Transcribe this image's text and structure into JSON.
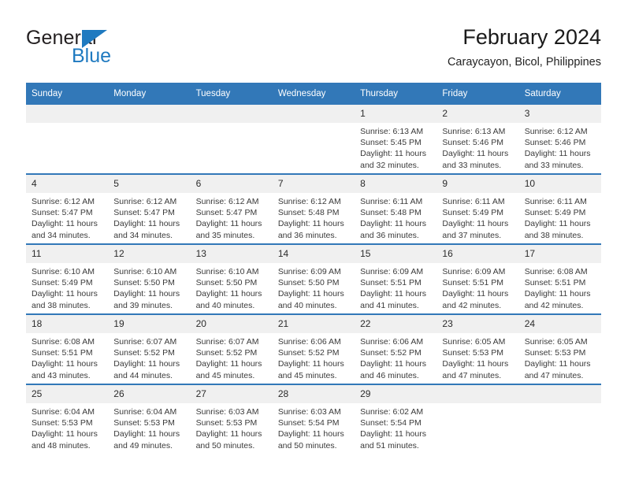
{
  "brand": {
    "name_dark": "General",
    "name_blue": "Blue",
    "triangle_icon": "triangle-logo-icon",
    "blue": "#1f7ac0"
  },
  "header": {
    "title": "February 2024",
    "subtitle": "Caraycayon, Bicol, Philippines"
  },
  "theme": {
    "header_blue": "#3278b8",
    "daynum_gray": "#f0f0f0"
  },
  "calendar": {
    "weekdays": [
      "Sunday",
      "Monday",
      "Tuesday",
      "Wednesday",
      "Thursday",
      "Friday",
      "Saturday"
    ],
    "weeks": [
      [
        {
          "day": "",
          "lines": []
        },
        {
          "day": "",
          "lines": []
        },
        {
          "day": "",
          "lines": []
        },
        {
          "day": "",
          "lines": []
        },
        {
          "day": "1",
          "lines": [
            "Sunrise: 6:13 AM",
            "Sunset: 5:45 PM",
            "Daylight: 11 hours and 32 minutes."
          ]
        },
        {
          "day": "2",
          "lines": [
            "Sunrise: 6:13 AM",
            "Sunset: 5:46 PM",
            "Daylight: 11 hours and 33 minutes."
          ]
        },
        {
          "day": "3",
          "lines": [
            "Sunrise: 6:12 AM",
            "Sunset: 5:46 PM",
            "Daylight: 11 hours and 33 minutes."
          ]
        }
      ],
      [
        {
          "day": "4",
          "lines": [
            "Sunrise: 6:12 AM",
            "Sunset: 5:47 PM",
            "Daylight: 11 hours and 34 minutes."
          ]
        },
        {
          "day": "5",
          "lines": [
            "Sunrise: 6:12 AM",
            "Sunset: 5:47 PM",
            "Daylight: 11 hours and 34 minutes."
          ]
        },
        {
          "day": "6",
          "lines": [
            "Sunrise: 6:12 AM",
            "Sunset: 5:47 PM",
            "Daylight: 11 hours and 35 minutes."
          ]
        },
        {
          "day": "7",
          "lines": [
            "Sunrise: 6:12 AM",
            "Sunset: 5:48 PM",
            "Daylight: 11 hours and 36 minutes."
          ]
        },
        {
          "day": "8",
          "lines": [
            "Sunrise: 6:11 AM",
            "Sunset: 5:48 PM",
            "Daylight: 11 hours and 36 minutes."
          ]
        },
        {
          "day": "9",
          "lines": [
            "Sunrise: 6:11 AM",
            "Sunset: 5:49 PM",
            "Daylight: 11 hours and 37 minutes."
          ]
        },
        {
          "day": "10",
          "lines": [
            "Sunrise: 6:11 AM",
            "Sunset: 5:49 PM",
            "Daylight: 11 hours and 38 minutes."
          ]
        }
      ],
      [
        {
          "day": "11",
          "lines": [
            "Sunrise: 6:10 AM",
            "Sunset: 5:49 PM",
            "Daylight: 11 hours and 38 minutes."
          ]
        },
        {
          "day": "12",
          "lines": [
            "Sunrise: 6:10 AM",
            "Sunset: 5:50 PM",
            "Daylight: 11 hours and 39 minutes."
          ]
        },
        {
          "day": "13",
          "lines": [
            "Sunrise: 6:10 AM",
            "Sunset: 5:50 PM",
            "Daylight: 11 hours and 40 minutes."
          ]
        },
        {
          "day": "14",
          "lines": [
            "Sunrise: 6:09 AM",
            "Sunset: 5:50 PM",
            "Daylight: 11 hours and 40 minutes."
          ]
        },
        {
          "day": "15",
          "lines": [
            "Sunrise: 6:09 AM",
            "Sunset: 5:51 PM",
            "Daylight: 11 hours and 41 minutes."
          ]
        },
        {
          "day": "16",
          "lines": [
            "Sunrise: 6:09 AM",
            "Sunset: 5:51 PM",
            "Daylight: 11 hours and 42 minutes."
          ]
        },
        {
          "day": "17",
          "lines": [
            "Sunrise: 6:08 AM",
            "Sunset: 5:51 PM",
            "Daylight: 11 hours and 42 minutes."
          ]
        }
      ],
      [
        {
          "day": "18",
          "lines": [
            "Sunrise: 6:08 AM",
            "Sunset: 5:51 PM",
            "Daylight: 11 hours and 43 minutes."
          ]
        },
        {
          "day": "19",
          "lines": [
            "Sunrise: 6:07 AM",
            "Sunset: 5:52 PM",
            "Daylight: 11 hours and 44 minutes."
          ]
        },
        {
          "day": "20",
          "lines": [
            "Sunrise: 6:07 AM",
            "Sunset: 5:52 PM",
            "Daylight: 11 hours and 45 minutes."
          ]
        },
        {
          "day": "21",
          "lines": [
            "Sunrise: 6:06 AM",
            "Sunset: 5:52 PM",
            "Daylight: 11 hours and 45 minutes."
          ]
        },
        {
          "day": "22",
          "lines": [
            "Sunrise: 6:06 AM",
            "Sunset: 5:52 PM",
            "Daylight: 11 hours and 46 minutes."
          ]
        },
        {
          "day": "23",
          "lines": [
            "Sunrise: 6:05 AM",
            "Sunset: 5:53 PM",
            "Daylight: 11 hours and 47 minutes."
          ]
        },
        {
          "day": "24",
          "lines": [
            "Sunrise: 6:05 AM",
            "Sunset: 5:53 PM",
            "Daylight: 11 hours and 47 minutes."
          ]
        }
      ],
      [
        {
          "day": "25",
          "lines": [
            "Sunrise: 6:04 AM",
            "Sunset: 5:53 PM",
            "Daylight: 11 hours and 48 minutes."
          ]
        },
        {
          "day": "26",
          "lines": [
            "Sunrise: 6:04 AM",
            "Sunset: 5:53 PM",
            "Daylight: 11 hours and 49 minutes."
          ]
        },
        {
          "day": "27",
          "lines": [
            "Sunrise: 6:03 AM",
            "Sunset: 5:53 PM",
            "Daylight: 11 hours and 50 minutes."
          ]
        },
        {
          "day": "28",
          "lines": [
            "Sunrise: 6:03 AM",
            "Sunset: 5:54 PM",
            "Daylight: 11 hours and 50 minutes."
          ]
        },
        {
          "day": "29",
          "lines": [
            "Sunrise: 6:02 AM",
            "Sunset: 5:54 PM",
            "Daylight: 11 hours and 51 minutes."
          ]
        },
        {
          "day": "",
          "lines": []
        },
        {
          "day": "",
          "lines": []
        }
      ]
    ]
  }
}
